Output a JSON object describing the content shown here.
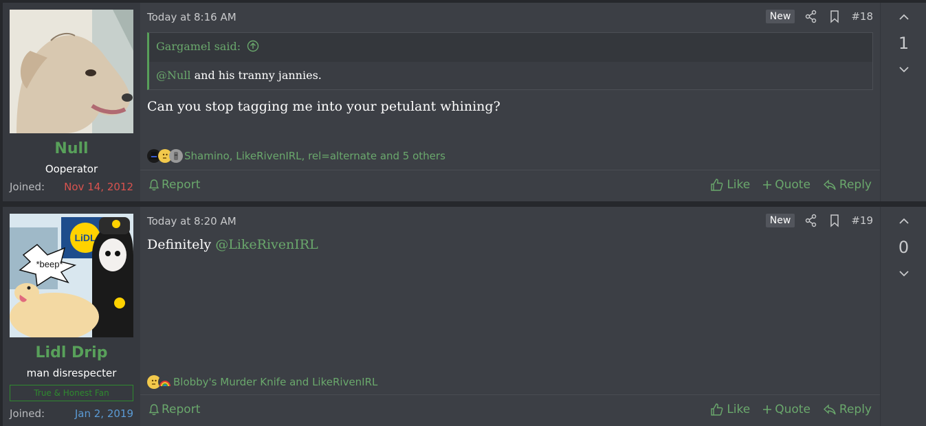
{
  "posts": [
    {
      "user": {
        "name": "Null",
        "title": "Ooperator",
        "joined_label": "Joined:",
        "joined": "Nov 14, 2012"
      },
      "date": "Today at 8:16 AM",
      "new_badge": "New",
      "post_number": "#18",
      "quote": {
        "author": "Gargamel said:",
        "mention": "@Null",
        "text": " and his tranny jannies."
      },
      "message": "Can you stop tagging me into your petulant whining?",
      "reactions_text": "Shamino, LikeRivenIRL, rel=alternate and 5 others",
      "vote_count": "1",
      "report": "Report",
      "like": "Like",
      "quote_action": "Quote",
      "reply": "Reply"
    },
    {
      "user": {
        "name": "Lidl Drip",
        "title": "man disrespecter",
        "banner": "True & Honest Fan",
        "joined_label": "Joined:",
        "joined": "Jan 2, 2019"
      },
      "date": "Today at 8:20 AM",
      "new_badge": "New",
      "post_number": "#19",
      "message_prefix": "Definitely ",
      "message_mention": "@LikeRivenIRL",
      "reactions_text": "Blobby's Murder Knife and LikeRivenIRL",
      "vote_count": "0",
      "report": "Report",
      "like": "Like",
      "quote_action": "Quote",
      "reply": "Reply",
      "avatar_text": "*beep*"
    }
  ],
  "colors": {
    "accent_green": "#58a05a",
    "joined_red": "#d9534f",
    "joined_blue": "#5b9bd5",
    "banner_green": "#2f8a2f"
  }
}
